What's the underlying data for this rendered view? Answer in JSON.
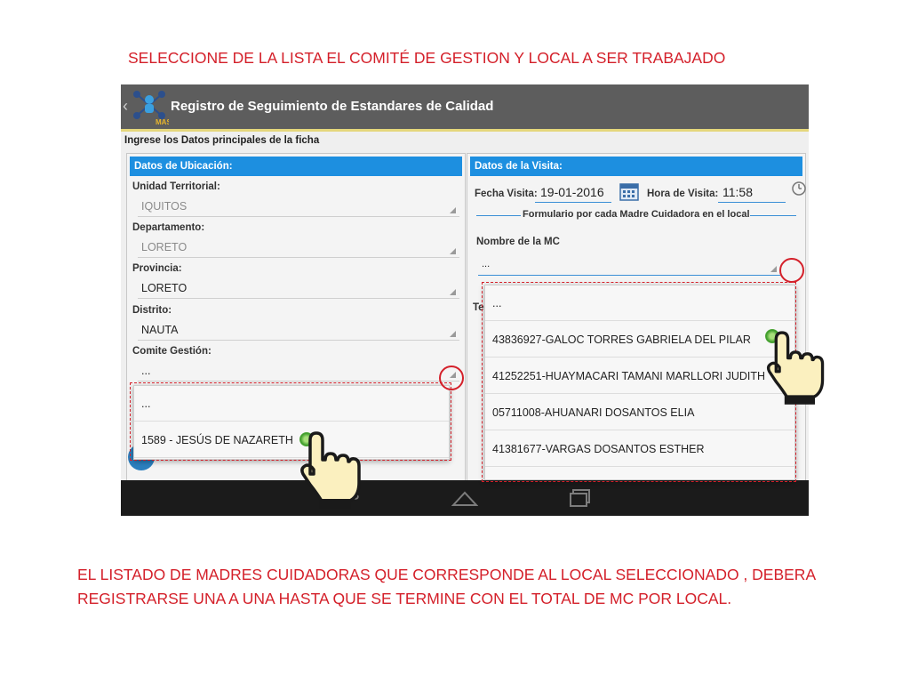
{
  "captions": {
    "top": "SELECCIONE DE LA LISTA EL COMITÉ DE GESTION  Y LOCAL A SER TRABAJADO",
    "bottom_line1": "EL LISTADO DE MADRES CUIDADORAS QUE CORRESPONDE AL LOCAL SELECCIONADO , DEBERA",
    "bottom_line2": "REGISTRARSE  UNA A UNA HASTA QUE SE TERMINE CON EL TOTAL DE MC POR LOCAL."
  },
  "app": {
    "title": "Registro de Seguimiento de Estandares de Calidad",
    "logo_text": "MAS",
    "subheader": "Ingrese los Datos principales de la ficha"
  },
  "ubicacion": {
    "header": "Datos de Ubicación:",
    "unidad_label": "Unidad Territorial:",
    "unidad_value": "IQUITOS",
    "departamento_label": "Departamento:",
    "departamento_value": "LORETO",
    "provincia_label": "Provincia:",
    "provincia_value": "LORETO",
    "distrito_label": "Distrito:",
    "distrito_value": "NAUTA",
    "comite_label": "Comite Gestión:",
    "comite_value": "...",
    "comite_options": [
      "...",
      "1589 - JESÚS DE NAZARETH"
    ]
  },
  "visita": {
    "header": "Datos de la Visita:",
    "fecha_label": "Fecha Visita:",
    "fecha_value": "19-01-2016",
    "hora_label": "Hora de Visita:",
    "hora_value": "11:58",
    "form_title": "Formulario por cada Madre Cuidadora en el local",
    "mc_label": "Nombre de la MC",
    "mc_value": "...",
    "hidden_label_fragment": "Te",
    "mc_options": [
      "...",
      "43836927-GALOC TORRES GABRIELA DEL PILAR",
      "41252251-HUAYMACARI TAMANI MARLLORI JUDITH",
      "05711008-AHUANARI DOSANTOS ELIA",
      "41381677-VARGAS DOSANTOS ESTHER"
    ]
  },
  "colors": {
    "caption": "#d4202a",
    "action_bar": "#5d5d5d",
    "panel_header": "#1d8fe0",
    "nav_bar": "#1b1b1b"
  },
  "icons": [
    "back-chevron-icon",
    "app-logo-icon",
    "calendar-icon",
    "clock-icon",
    "spinner-arrow-icon",
    "pointing-hand-icon",
    "nav-back-icon",
    "nav-home-icon",
    "nav-recents-icon"
  ]
}
